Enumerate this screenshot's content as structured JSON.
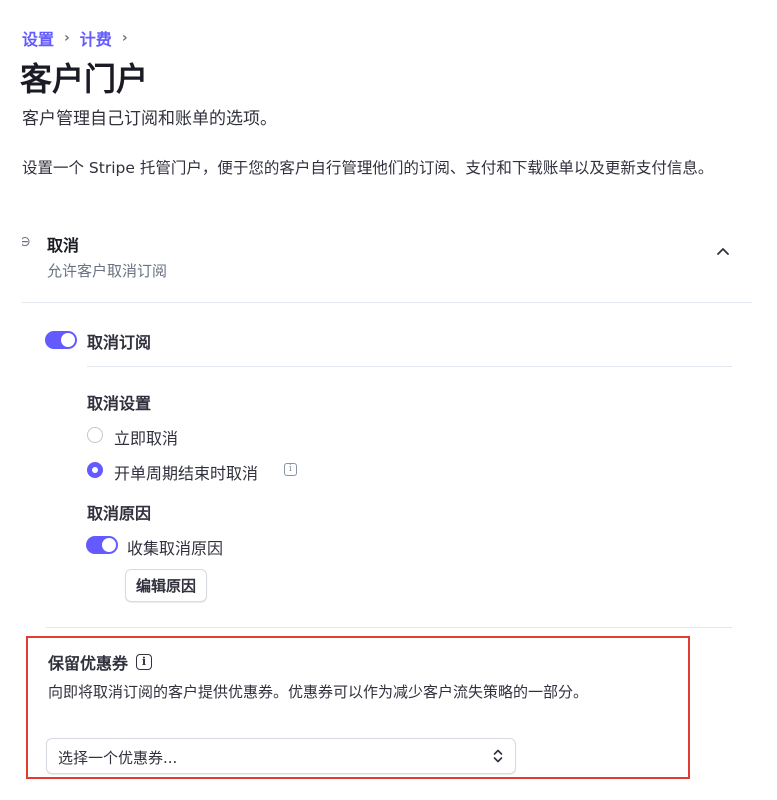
{
  "breadcrumb": {
    "item1": "设置",
    "item2": "计费",
    "separator": "›"
  },
  "page": {
    "title": "客户门户",
    "subtitle": "客户管理自己订阅和账单的选项。",
    "description": "设置一个 Stripe 托管门户，便于您的客户自行管理他们的订阅、支付和下载账单以及更新支付信息。"
  },
  "cancel_section": {
    "title": "取消",
    "subtitle": "允许客户取消订阅",
    "toggle_label": "取消订阅",
    "settings_heading": "取消设置",
    "option_immediate": "立即取消",
    "option_end_of_period": "开单周期结束时取消",
    "reasons_heading": "取消原因",
    "collect_reasons_label": "收集取消原因",
    "edit_reasons_button": "编辑原因"
  },
  "retention_coupon": {
    "title": "保留优惠券",
    "info_glyph": "i",
    "description": "向即将取消订阅的客户提供优惠券。优惠券可以作为减少客户流失策略的一部分。",
    "select_placeholder": "选择一个优惠券..."
  },
  "colors": {
    "accent": "#635bff",
    "highlight_border": "#e03c31"
  }
}
